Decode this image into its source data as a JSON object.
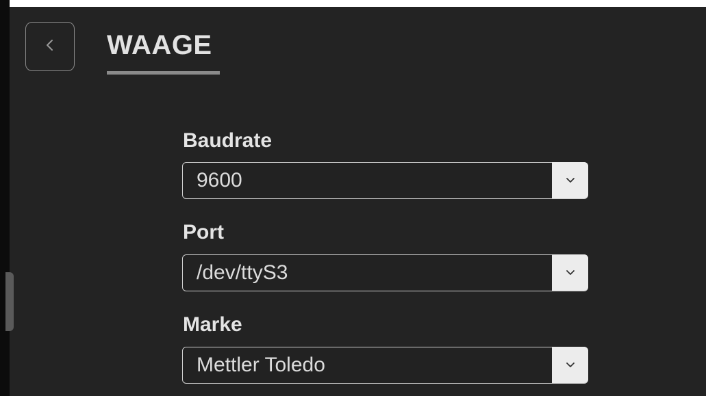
{
  "header": {
    "title": "WAAGE",
    "back_icon": "chevron-left-icon"
  },
  "fields": [
    {
      "label": "Baudrate",
      "value": "9600",
      "icon": "chevron-down-icon"
    },
    {
      "label": "Port",
      "value": "/dev/ttyS3",
      "icon": "chevron-down-icon"
    },
    {
      "label": "Marke",
      "value": "Mettler Toledo",
      "icon": "chevron-down-icon"
    }
  ],
  "colors": {
    "background": "#232323",
    "text": "#e6e6e6",
    "border": "#cfcfcf",
    "chevron_button": "#ececec"
  }
}
